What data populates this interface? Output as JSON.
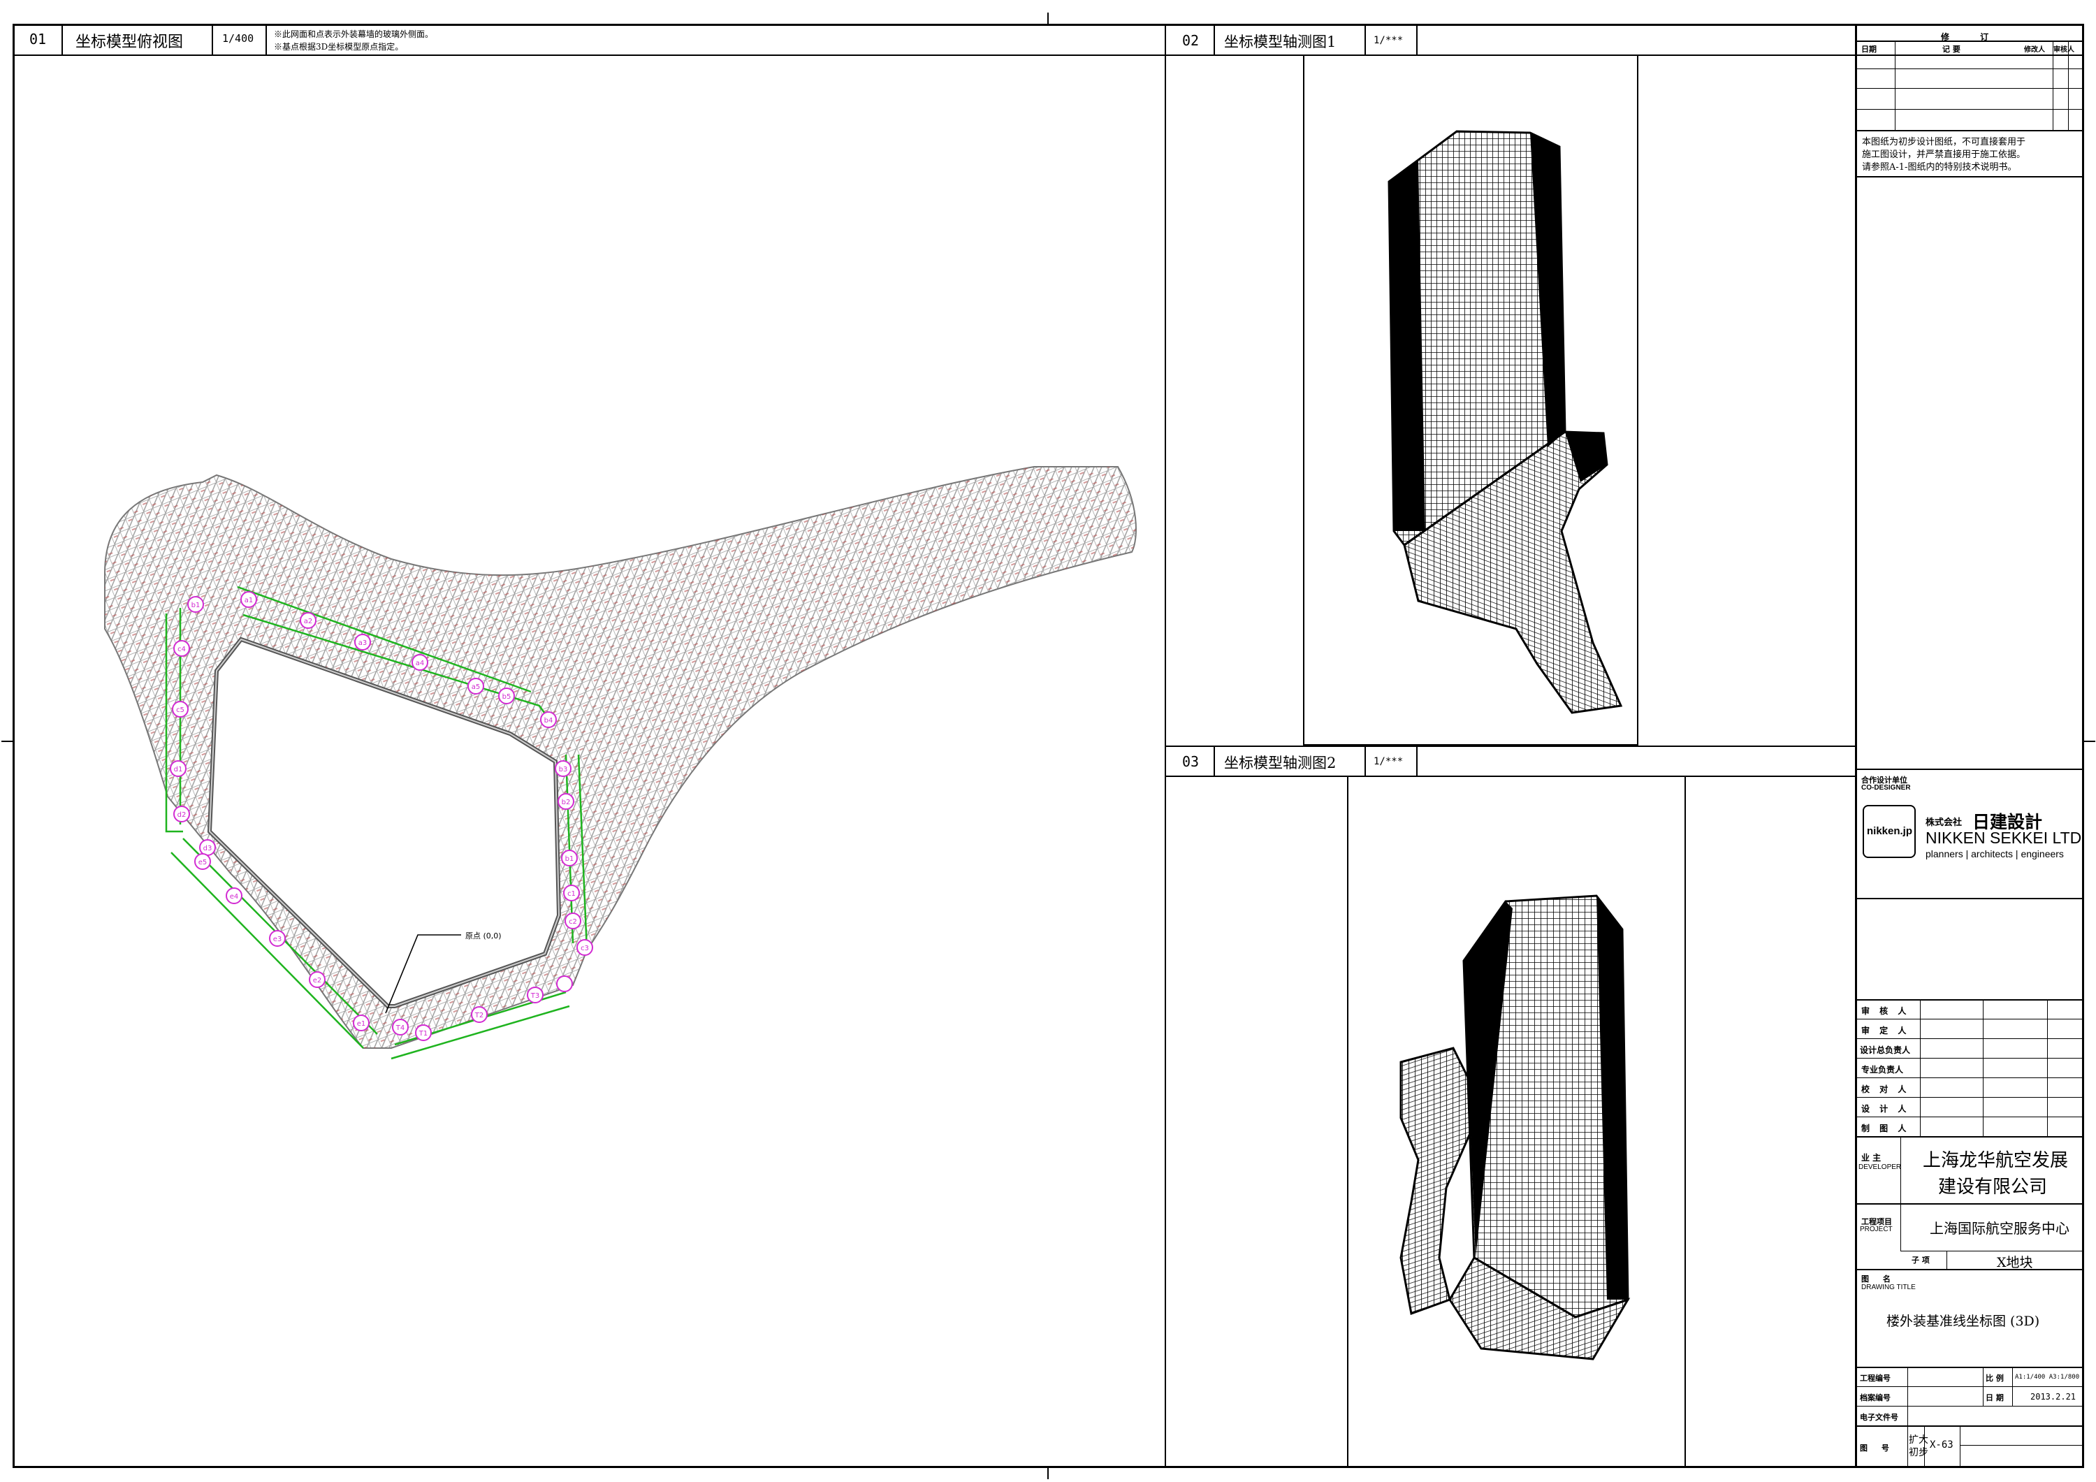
{
  "views": {
    "v01": {
      "num": "01",
      "title": "坐标模型俯视图",
      "scale": "1/400",
      "note1": "※此网面和点表示外装幕墙的玻璃外侧面。",
      "note2": "※基点根据3D坐标模型原点指定。",
      "origin_label": "原点 (0,0)"
    },
    "v02": {
      "num": "02",
      "title": "坐标模型轴测图1",
      "scale": "1/***"
    },
    "v03": {
      "num": "03",
      "title": "坐标模型轴测图2",
      "scale": "1/***"
    }
  },
  "plan_points": [
    "b1",
    "a1",
    "a2",
    "a3",
    "a4",
    "a5",
    "b5",
    "b4",
    "b3",
    "b2",
    "b1",
    "c1",
    "c2",
    "c3",
    "c4",
    "c5",
    "d1",
    "d2",
    "d3",
    "e5",
    "e4",
    "e3",
    "e2",
    "e1",
    "T4",
    "T1",
    "T2",
    "T3"
  ],
  "title_block": {
    "revision_header": "修  订",
    "rev_cols": [
      "日期",
      "记  要",
      "修改人",
      "审核人"
    ],
    "notice": [
      "本图纸为初步设计图纸，不可直接套用于",
      "施工图设计，并严禁直接用于施工依据。",
      "请参照A-1-图纸内的特别技术说明书。"
    ],
    "codesigner_cn": "合作设计单位",
    "codesigner_en": "CO-DESIGNER",
    "logo_box": "nikken.jp",
    "firm_jp_small": "株式会社",
    "firm_jp": "日建設計",
    "firm_en": "NIKKEN SEKKEI LTD",
    "firm_tagline": "planners | architects | engineers",
    "signoff": [
      "审  核  人",
      "审  定  人",
      "设计总负责人",
      "专业负责人",
      "校  对  人",
      "设  计  人",
      "制  图  人"
    ],
    "developer_cn": "业  主",
    "developer_en": "DEVELOPER",
    "developer_line1": "上海龙华航空发展",
    "developer_line2": "建设有限公司",
    "project_cn": "工程项目",
    "project_en": "PROJECT",
    "project_name": "上海国际航空服务中心",
    "subitem_label": "子  项",
    "subitem": "X地块",
    "drawing_title_cn": "图  名",
    "drawing_title_en": "DRAWING TITLE",
    "drawing_title": "楼外装基准线坐标图 (3D)",
    "job_no_label": "工程编号",
    "scale_label": "比  例",
    "scale_value": "A1:1/400 A3:1/800",
    "archive_label": "档案编号",
    "date_label": "日  期",
    "date_value": "2013.2.21",
    "efile_label": "电子文件号",
    "drawing_no_label": "图  号",
    "drawing_no_stage_a": "扩大",
    "drawing_no_stage_b": "初步",
    "drawing_no": "X-63"
  }
}
